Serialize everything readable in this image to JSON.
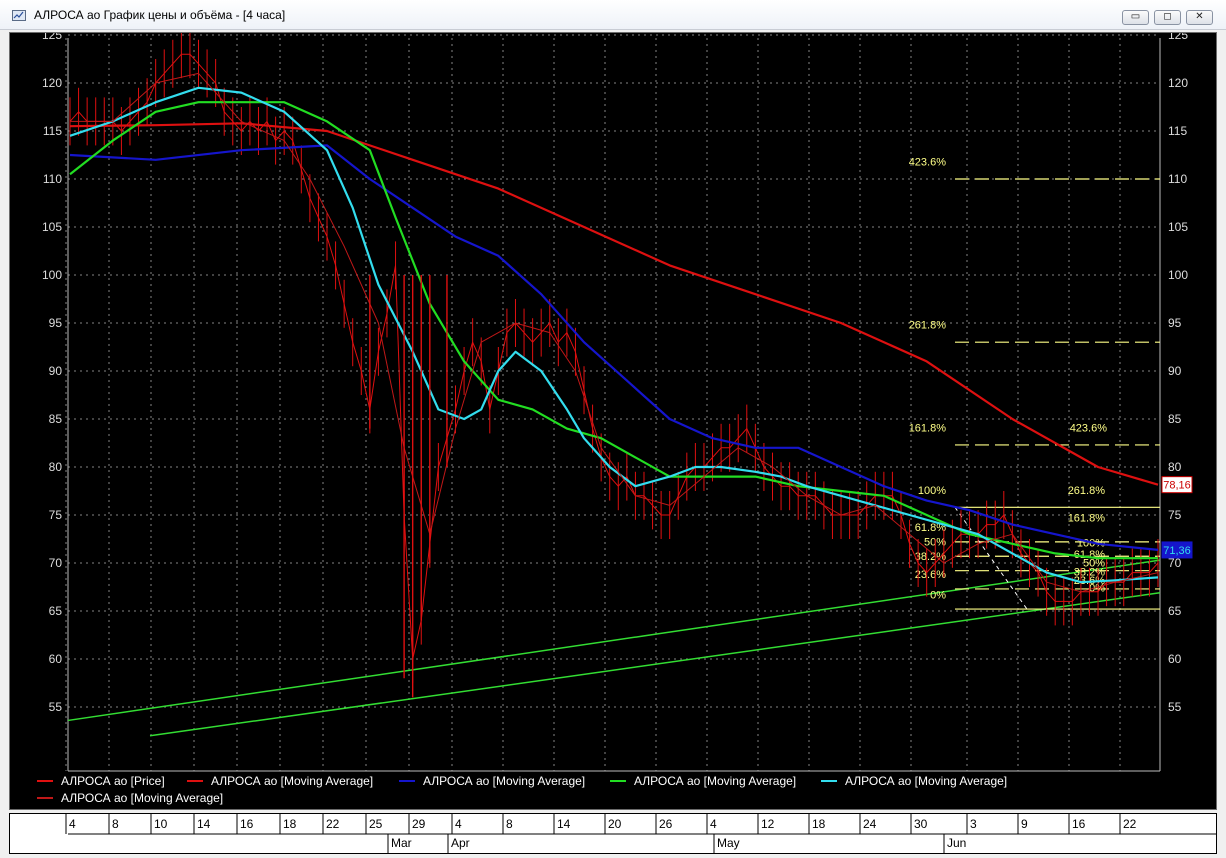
{
  "window": {
    "title": "АЛРОСА ао График цены и объёма - [4 часа]",
    "buttons": {
      "minimize": "▭",
      "restore": "◻",
      "close": "✕"
    }
  },
  "colors": {
    "price": "#e01010",
    "ma_long": "#dd1010",
    "ma_mid": "#1515cc",
    "ma_green": "#22dd22",
    "ma_cyan": "#33ddee",
    "ma_thin": "#c01818",
    "trend": "#33dd33",
    "fib": "#ffff88",
    "grid": "#bbbbbb"
  },
  "chart_data": {
    "type": "line",
    "y_ticks": [
      "125",
      "120",
      "115",
      "110",
      "105",
      "100",
      "95",
      "90",
      "85",
      "80",
      "75",
      "70",
      "65",
      "60",
      "55"
    ],
    "ylim": [
      52,
      127
    ],
    "x_ticks": [
      "4",
      "8",
      "10",
      "14",
      "16",
      "18",
      "22",
      "25",
      "29",
      "4",
      "8",
      "14",
      "20",
      "26",
      "4",
      "12",
      "18",
      "24",
      "30",
      "3",
      "9",
      "16",
      "22"
    ],
    "months": [
      "Mar",
      "Apr",
      "May",
      "Jun"
    ],
    "last_values": {
      "red_ma": "78,16",
      "blue_ma": "71,36"
    },
    "legend": [
      "АЛРОСА ао [Price]",
      "АЛРОСА ао [Moving Average]",
      "АЛРОСА ао [Moving Average]",
      "АЛРОСА ао [Moving Average]",
      "АЛРОСА ао [Moving Average]",
      "АЛРОСА ао [Moving Average]"
    ],
    "fib_labels": {
      "l4236_top": "423.6%",
      "l2618_mid": "261.8%",
      "l1618_left": "161.8%",
      "l4236_right": "423.6%",
      "l2618_right": "261.8%",
      "l1618_right": "161.8%",
      "l100_left": "100%",
      "l618": "61.8%",
      "l50": "50%",
      "l382": "38.2%",
      "l236": "23.6%",
      "l0_left": "0%",
      "l100_right": "100%",
      "l618_right": "61.8%",
      "l50_right": "50%",
      "l382_right": "38.2%",
      "l236_right": "23.6%",
      "l0_right": "0%"
    },
    "series": [
      {
        "key": "price",
        "points": [
          [
            0,
            116
          ],
          [
            1,
            117
          ],
          [
            2,
            116
          ],
          [
            3,
            116
          ],
          [
            4,
            116
          ],
          [
            5,
            116
          ],
          [
            6,
            115
          ],
          [
            7,
            116
          ],
          [
            8,
            117
          ],
          [
            9,
            118
          ],
          [
            10,
            120
          ],
          [
            11,
            121
          ],
          [
            12,
            122
          ],
          [
            13,
            123
          ],
          [
            14,
            123
          ],
          [
            15,
            122
          ],
          [
            16,
            121
          ],
          [
            17,
            120
          ],
          [
            18,
            117
          ],
          [
            19,
            116
          ],
          [
            20,
            115
          ],
          [
            21,
            116
          ],
          [
            22,
            115
          ],
          [
            23,
            116
          ],
          [
            24,
            114
          ],
          [
            25,
            115
          ],
          [
            26,
            114
          ],
          [
            27,
            111
          ],
          [
            28,
            108
          ],
          [
            29,
            106
          ],
          [
            30,
            104
          ],
          [
            31,
            101
          ],
          [
            32,
            97
          ],
          [
            33,
            93
          ],
          [
            34,
            90
          ],
          [
            35,
            86
          ],
          [
            36,
            92
          ],
          [
            37,
            96
          ],
          [
            38,
            101
          ],
          [
            39,
            75
          ],
          [
            40,
            60
          ],
          [
            41,
            64
          ],
          [
            42,
            72
          ],
          [
            43,
            80
          ],
          [
            44,
            83
          ],
          [
            45,
            86
          ],
          [
            46,
            90
          ],
          [
            47,
            93
          ],
          [
            48,
            91
          ],
          [
            49,
            86
          ],
          [
            50,
            90
          ],
          [
            51,
            94
          ],
          [
            52,
            95
          ],
          [
            53,
            94
          ],
          [
            54,
            93
          ],
          [
            55,
            94
          ],
          [
            56,
            95
          ],
          [
            57,
            93
          ],
          [
            58,
            94
          ],
          [
            59,
            92
          ],
          [
            60,
            88
          ],
          [
            61,
            84
          ],
          [
            62,
            81
          ],
          [
            63,
            79
          ],
          [
            64,
            78
          ],
          [
            65,
            79
          ],
          [
            66,
            77
          ],
          [
            67,
            77
          ],
          [
            68,
            76
          ],
          [
            69,
            75
          ],
          [
            70,
            75
          ],
          [
            71,
            77
          ],
          [
            72,
            79
          ],
          [
            73,
            80
          ],
          [
            74,
            80
          ],
          [
            75,
            81
          ],
          [
            76,
            82
          ],
          [
            77,
            82
          ],
          [
            78,
            83
          ],
          [
            79,
            84
          ],
          [
            80,
            82
          ],
          [
            81,
            80
          ],
          [
            82,
            79
          ],
          [
            83,
            78
          ],
          [
            84,
            78
          ],
          [
            85,
            77
          ],
          [
            86,
            77
          ],
          [
            87,
            77
          ],
          [
            88,
            76
          ],
          [
            89,
            75
          ],
          [
            90,
            75
          ],
          [
            91,
            75
          ],
          [
            92,
            75
          ],
          [
            93,
            76
          ],
          [
            94,
            77
          ],
          [
            95,
            77
          ],
          [
            96,
            77
          ],
          [
            97,
            75
          ],
          [
            98,
            72
          ],
          [
            99,
            70
          ],
          [
            100,
            69
          ],
          [
            101,
            70
          ],
          [
            102,
            71
          ],
          [
            103,
            72
          ],
          [
            104,
            73
          ],
          [
            105,
            73
          ],
          [
            106,
            73
          ],
          [
            107,
            74
          ],
          [
            108,
            74
          ],
          [
            109,
            75
          ],
          [
            110,
            73
          ],
          [
            111,
            71
          ],
          [
            112,
            70
          ],
          [
            113,
            69
          ],
          [
            114,
            67
          ],
          [
            115,
            66
          ],
          [
            116,
            66
          ],
          [
            117,
            66
          ],
          [
            118,
            67
          ],
          [
            119,
            67
          ],
          [
            120,
            67
          ],
          [
            121,
            68
          ],
          [
            122,
            68
          ],
          [
            123,
            68
          ],
          [
            124,
            69
          ],
          [
            125,
            69
          ],
          [
            126,
            69
          ],
          [
            127,
            70
          ]
        ]
      },
      {
        "key": "ma_long",
        "points": [
          [
            0,
            115.5
          ],
          [
            10,
            115.6
          ],
          [
            20,
            115.8
          ],
          [
            30,
            115
          ],
          [
            40,
            112
          ],
          [
            50,
            109
          ],
          [
            60,
            105
          ],
          [
            70,
            101
          ],
          [
            80,
            98
          ],
          [
            90,
            95
          ],
          [
            100,
            91
          ],
          [
            110,
            85
          ],
          [
            120,
            80
          ],
          [
            127,
            78.16
          ]
        ]
      },
      {
        "key": "ma_mid",
        "points": [
          [
            0,
            112.5
          ],
          [
            10,
            112
          ],
          [
            20,
            113
          ],
          [
            30,
            113.5
          ],
          [
            35,
            110
          ],
          [
            40,
            107
          ],
          [
            45,
            104
          ],
          [
            50,
            102
          ],
          [
            55,
            98
          ],
          [
            60,
            93
          ],
          [
            65,
            89
          ],
          [
            70,
            85
          ],
          [
            75,
            83
          ],
          [
            80,
            82
          ],
          [
            85,
            82
          ],
          [
            90,
            80
          ],
          [
            95,
            78
          ],
          [
            100,
            76.5
          ],
          [
            105,
            75.5
          ],
          [
            110,
            74
          ],
          [
            115,
            73
          ],
          [
            120,
            72
          ],
          [
            127,
            71.36
          ]
        ]
      },
      {
        "key": "ma_green",
        "points": [
          [
            0,
            110.5
          ],
          [
            5,
            114
          ],
          [
            10,
            117
          ],
          [
            15,
            118
          ],
          [
            20,
            118
          ],
          [
            25,
            118
          ],
          [
            30,
            116
          ],
          [
            35,
            113
          ],
          [
            38,
            106
          ],
          [
            42,
            97
          ],
          [
            46,
            91
          ],
          [
            50,
            87
          ],
          [
            54,
            86
          ],
          [
            58,
            84
          ],
          [
            62,
            83
          ],
          [
            66,
            81
          ],
          [
            70,
            79
          ],
          [
            75,
            79
          ],
          [
            80,
            79
          ],
          [
            85,
            78
          ],
          [
            90,
            77.5
          ],
          [
            95,
            77
          ],
          [
            100,
            75
          ],
          [
            105,
            73
          ],
          [
            110,
            72
          ],
          [
            115,
            71
          ],
          [
            120,
            70.5
          ],
          [
            127,
            70.5
          ]
        ]
      },
      {
        "key": "ma_cyan",
        "points": [
          [
            0,
            114.5
          ],
          [
            5,
            116
          ],
          [
            10,
            118
          ],
          [
            15,
            119.5
          ],
          [
            20,
            119
          ],
          [
            25,
            117
          ],
          [
            30,
            113
          ],
          [
            33,
            107
          ],
          [
            36,
            99
          ],
          [
            40,
            92
          ],
          [
            43,
            86
          ],
          [
            46,
            85
          ],
          [
            48,
            86
          ],
          [
            50,
            90
          ],
          [
            52,
            92
          ],
          [
            55,
            90
          ],
          [
            58,
            86
          ],
          [
            60,
            83
          ],
          [
            63,
            80
          ],
          [
            66,
            78
          ],
          [
            70,
            79
          ],
          [
            73,
            80
          ],
          [
            76,
            80
          ],
          [
            80,
            79.5
          ],
          [
            83,
            79
          ],
          [
            86,
            78
          ],
          [
            90,
            77
          ],
          [
            94,
            76
          ],
          [
            98,
            75
          ],
          [
            102,
            74
          ],
          [
            106,
            73
          ],
          [
            110,
            71
          ],
          [
            114,
            69
          ],
          [
            118,
            68
          ],
          [
            122,
            68.2
          ],
          [
            127,
            68.5
          ]
        ]
      },
      {
        "key": "ma_thin",
        "points": [
          [
            0,
            116
          ],
          [
            5,
            116
          ],
          [
            10,
            120
          ],
          [
            15,
            121
          ],
          [
            20,
            116
          ],
          [
            25,
            114
          ],
          [
            28,
            110
          ],
          [
            32,
            103
          ],
          [
            36,
            95
          ],
          [
            39,
            82
          ],
          [
            42,
            73
          ],
          [
            45,
            84
          ],
          [
            48,
            93
          ],
          [
            52,
            95
          ],
          [
            56,
            94
          ],
          [
            59,
            90
          ],
          [
            62,
            82
          ],
          [
            66,
            77
          ],
          [
            70,
            76
          ],
          [
            74,
            79
          ],
          [
            78,
            82
          ],
          [
            82,
            80
          ],
          [
            86,
            77
          ],
          [
            90,
            75
          ],
          [
            94,
            76
          ],
          [
            98,
            73
          ],
          [
            102,
            70
          ],
          [
            106,
            72
          ],
          [
            110,
            73
          ],
          [
            114,
            68
          ],
          [
            118,
            67
          ],
          [
            122,
            68
          ],
          [
            127,
            69
          ]
        ]
      }
    ]
  }
}
